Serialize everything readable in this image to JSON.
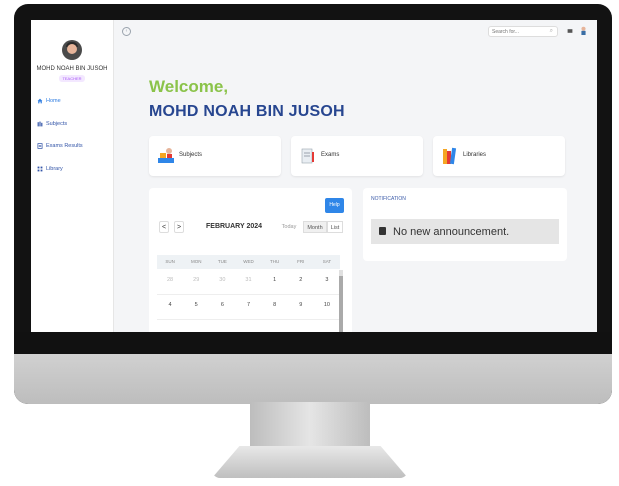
{
  "user": {
    "name": "MOHD NOAH BIN JUSOH",
    "role": "TEACHER"
  },
  "sidebar": {
    "items": [
      {
        "label": "Home",
        "icon": "home-icon",
        "active": true
      },
      {
        "label": "Subjects",
        "icon": "subjects-icon",
        "active": false
      },
      {
        "label": "Exams Results",
        "icon": "exam-results-icon",
        "active": false
      },
      {
        "label": "Library",
        "icon": "library-icon",
        "active": false
      }
    ]
  },
  "topbar": {
    "search_placeholder": "Search for..."
  },
  "main": {
    "welcome": "Welcome,",
    "fullname": "MOHD NOAH BIN JUSOH"
  },
  "cards": [
    {
      "label": "Subjects",
      "icon": "subjects-illustration-icon"
    },
    {
      "label": "Exams",
      "icon": "exams-illustration-icon"
    },
    {
      "label": "Libraries",
      "icon": "books-illustration-icon"
    }
  ],
  "calendar": {
    "help_label": "Help",
    "title": "FEBRUARY 2024",
    "prev": "<",
    "next": ">",
    "today_label": "Today",
    "month_label": "Month",
    "list_label": "List",
    "weekdays": [
      "SUN",
      "MON",
      "TUE",
      "WED",
      "THU",
      "FRI",
      "SAT"
    ],
    "weeks": [
      [
        "28",
        "29",
        "30",
        "31",
        "1",
        "2",
        "3"
      ],
      [
        "4",
        "5",
        "6",
        "7",
        "8",
        "9",
        "10"
      ]
    ]
  },
  "notification": {
    "title": "NOTIFICATION",
    "message": "No new announcement."
  },
  "colors": {
    "accent": "#2f86e8",
    "welcome": "#8bc34a",
    "name": "#274690"
  }
}
